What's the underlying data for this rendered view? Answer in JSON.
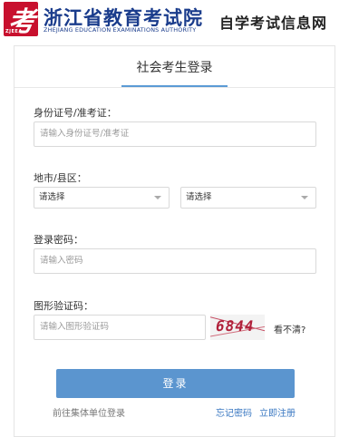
{
  "header": {
    "badge_glyph": "考",
    "badge_text": "ZJEEA",
    "org_name": "浙江省教育考试院",
    "org_name_en": "ZHEJIANG EDUCATION EXAMINATIONS AUTHORITY",
    "site_name": "自学考试信息网"
  },
  "login": {
    "title": "社会考生登录",
    "id_label": "身份证号/准考证：",
    "id_placeholder": "请输入身份证号/准考证",
    "region_label": "地市/县区：",
    "city_select": "请选择",
    "county_select": "请选择",
    "password_label": "登录密码：",
    "password_placeholder": "请输入密码",
    "captcha_label": "图形验证码：",
    "captcha_placeholder": "请输入图形验证码",
    "captcha_value": "6844",
    "refresh_text": "看不清?",
    "submit_label": "登录",
    "group_login_link": "前往集体单位登录",
    "forgot_link": "忘记密码",
    "register_link": "立即注册"
  },
  "colors": {
    "brand_blue": "#1a3c8c",
    "badge_red": "#c8102e",
    "button_blue": "#5b95cf",
    "link_blue": "#3a78c2"
  }
}
